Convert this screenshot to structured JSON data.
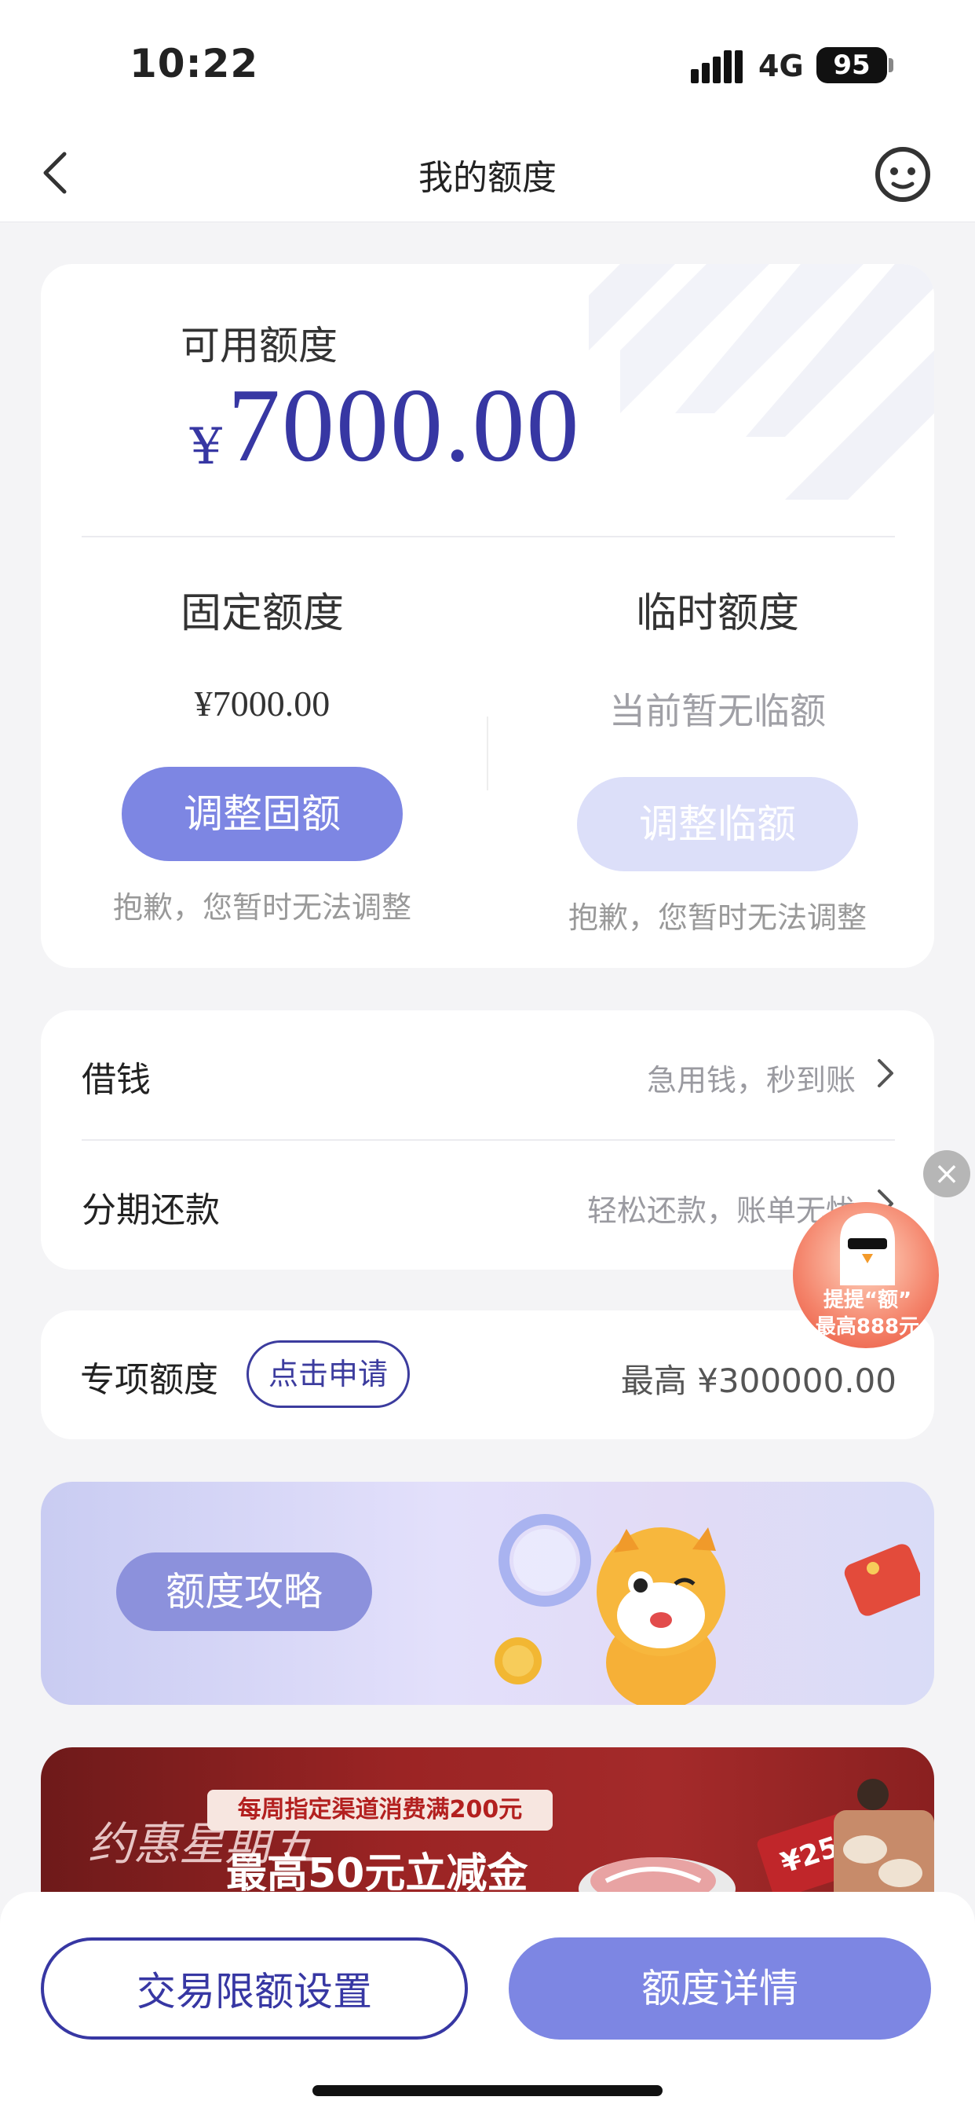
{
  "status": {
    "time": "10:22",
    "network": "4G",
    "battery": "95"
  },
  "nav": {
    "title": "我的额度"
  },
  "credit": {
    "available_label": "可用额度",
    "currency_symbol": "¥",
    "available_amount": "7000.00",
    "fixed": {
      "title": "固定额度",
      "value": "¥7000.00",
      "button": "调整固额",
      "note": "抱歉，您暂时无法调整"
    },
    "temp": {
      "title": "临时额度",
      "value": "当前暂无临额",
      "button": "调整临额",
      "note": "抱歉，您暂时无法调整"
    }
  },
  "menu": [
    {
      "label": "借钱",
      "hint": "急用钱，秒到账"
    },
    {
      "label": "分期还款",
      "hint": "轻松还款，账单无忧"
    }
  ],
  "special": {
    "label": "专项额度",
    "apply": "点击申请",
    "max": "最高 ¥300000.00"
  },
  "banner1": {
    "label": "额度攻略"
  },
  "banner2": {
    "tag": "每周指定渠道消费满200元",
    "headline": "最高50元立减金",
    "logo": "约惠星期五",
    "price": "¥25"
  },
  "floating": {
    "line1": "提提“额”",
    "line2": "最高888元"
  },
  "bottom": {
    "left_button": "交易限额设置",
    "right_button": "额度详情"
  },
  "colors": {
    "primary": "#7d86e3",
    "dark_blue": "#3737a3"
  }
}
